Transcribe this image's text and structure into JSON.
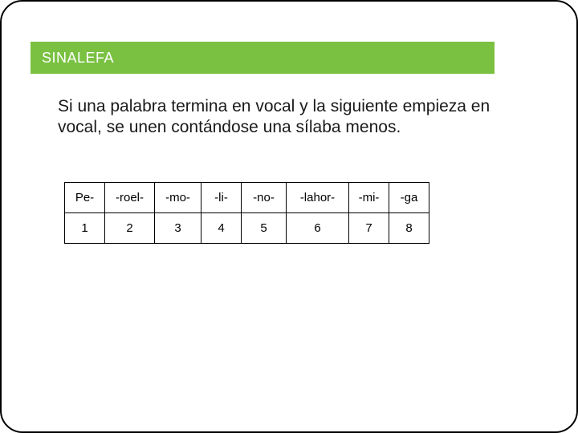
{
  "header": {
    "title": "SINALEFA"
  },
  "body": {
    "text": "Si una palabra termina en vocal y la siguiente empieza en vocal, se unen contándose una sílaba menos."
  },
  "syllable_table": {
    "row1": [
      "Pe-",
      "-roel-",
      "-mo-",
      "-li-",
      "-no-",
      "-lahor-",
      "-mi-",
      "-ga"
    ],
    "row2": [
      "1",
      "2",
      "3",
      "4",
      "5",
      "6",
      "7",
      "8"
    ]
  }
}
